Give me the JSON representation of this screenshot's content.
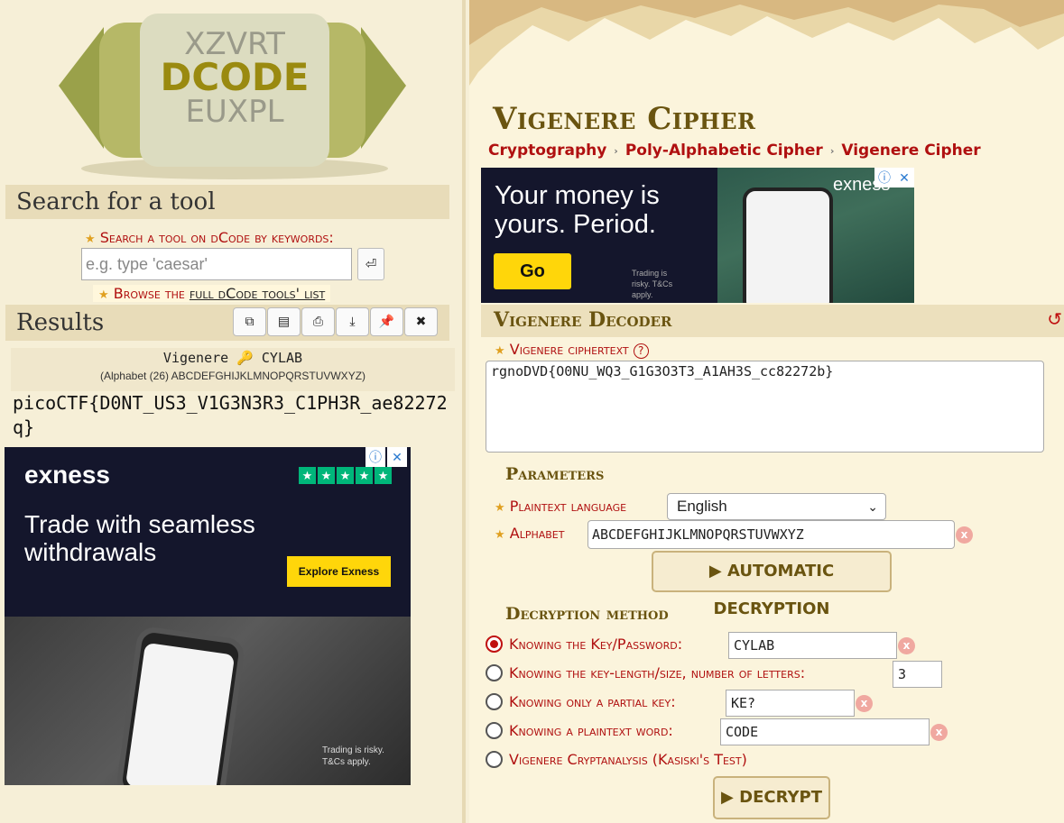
{
  "left": {
    "logo_text": "DCODE",
    "logo_letters_top": "XZVRT",
    "logo_letters_bottom": "EUXPL",
    "search": {
      "heading": "Search for a tool",
      "label": "Search a tool on dCode by keywords:",
      "placeholder": "e.g. type 'caesar'",
      "go_icon": "⏎",
      "browse_prefix": "Browse the ",
      "browse_link": "full dCode tools' list"
    },
    "results": {
      "heading": "Results",
      "tools": [
        {
          "icon": "copy-icon",
          "glyph": "⧉"
        },
        {
          "icon": "paste-icon",
          "glyph": "▤"
        },
        {
          "icon": "print-icon",
          "glyph": "⎙"
        },
        {
          "icon": "download-icon",
          "glyph": "⤓"
        },
        {
          "icon": "pin-icon",
          "glyph": "📌"
        },
        {
          "icon": "close-icon",
          "glyph": "✖"
        }
      ],
      "title": "Vigenere 🔑 CYLAB",
      "alphabet_note": "(Alphabet (26) ABCDEFGHIJKLMNOPQRSTUVWXYZ)",
      "output": "picoCTF{D0NT_US3_V1G3N3R3_C1PH3R_ae82272q}"
    },
    "ad": {
      "brand": "exness",
      "headline": "Trade with seamless withdrawals",
      "cta": "Explore Exness",
      "risk": "Trading is risky. T&Cs apply."
    }
  },
  "right": {
    "title": "Vigenere Cipher",
    "breadcrumb": [
      "Cryptography",
      "Poly-Alphabetic Cipher",
      "Vigenere Cipher"
    ],
    "ad": {
      "headline": "Your money is yours. Period.",
      "cta": "Go",
      "brand": "exness",
      "risk": "Trading is risky. T&Cs apply."
    },
    "decoder": {
      "title": "Vigenere Decoder",
      "ciphertext_label": "Vigenere ciphertext",
      "ciphertext": "rgnoDVD{O0NU_WQ3_G1G3O3T3_A1AH3S_cc82272b}",
      "params_head": "Parameters",
      "lang_label": "Plaintext language",
      "lang_value": "English",
      "alphabet_label": "Alphabet",
      "alphabet_value": "ABCDEFGHIJKLMNOPQRSTUVWXYZ",
      "auto_button": "Automatic Decryption",
      "method_head": "Decryption method",
      "methods": [
        {
          "label": "Knowing the Key/Password:",
          "value": "CYLAB",
          "selected": true
        },
        {
          "label": "Knowing the key-length/size, number of letters:",
          "value": "3",
          "selected": false
        },
        {
          "label": "Knowing only a partial key:",
          "value": "KE?",
          "selected": false
        },
        {
          "label": "Knowing a plaintext word:",
          "value": "CODE",
          "selected": false
        },
        {
          "label": "Vigenere Cryptanalysis (Kasiski's Test)",
          "value": "",
          "selected": false
        }
      ],
      "decrypt_button": "Decrypt"
    }
  }
}
